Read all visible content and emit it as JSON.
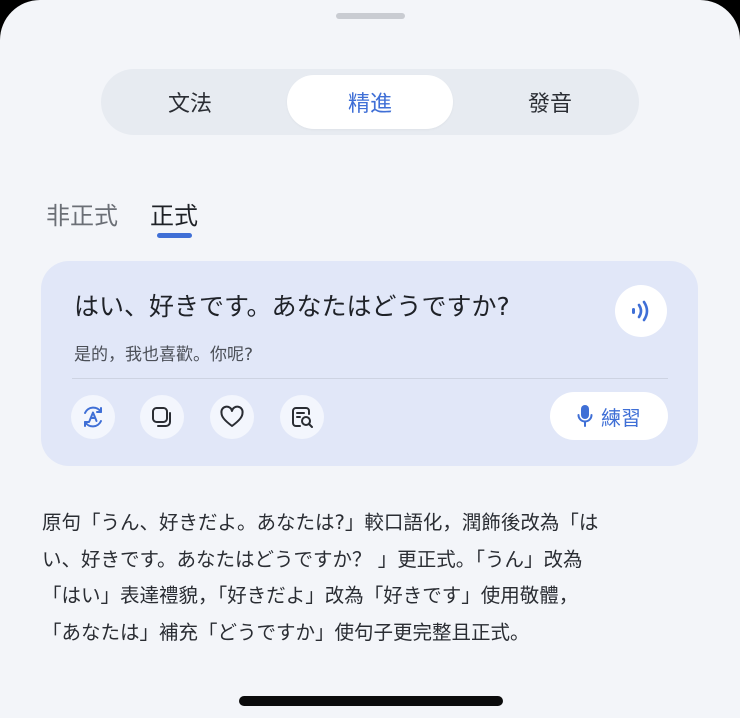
{
  "segment_tabs": [
    {
      "label": "文法",
      "active": false
    },
    {
      "label": "精進",
      "active": true
    },
    {
      "label": "發音",
      "active": false
    }
  ],
  "tone_tabs": [
    {
      "label": "非正式",
      "active": false
    },
    {
      "label": "正式",
      "active": true
    }
  ],
  "card": {
    "japanese": "はい、好きです。あなたはどうですか?",
    "translation": "是的，我也喜歡。你呢?",
    "practice_label": "練習",
    "actions": [
      "translate-icon",
      "copy-icon",
      "heart-icon",
      "search-doc-icon"
    ]
  },
  "explanation_lines": [
    "原句「うん、好きだよ。あなたは?」較口語化，潤飾後改為「は",
    "い、好きです。あなたはどうですか？ 」更正式。「うん」改為",
    "「はい」表達禮貌，「好きだよ」改為「好きです」使用敬體，",
    "「あなたは」補充「どうですか」使句子更完整且正式。"
  ],
  "colors": {
    "accent": "#3f6fd6",
    "background": "#f3f5f9",
    "card": "#e1e7f8"
  }
}
